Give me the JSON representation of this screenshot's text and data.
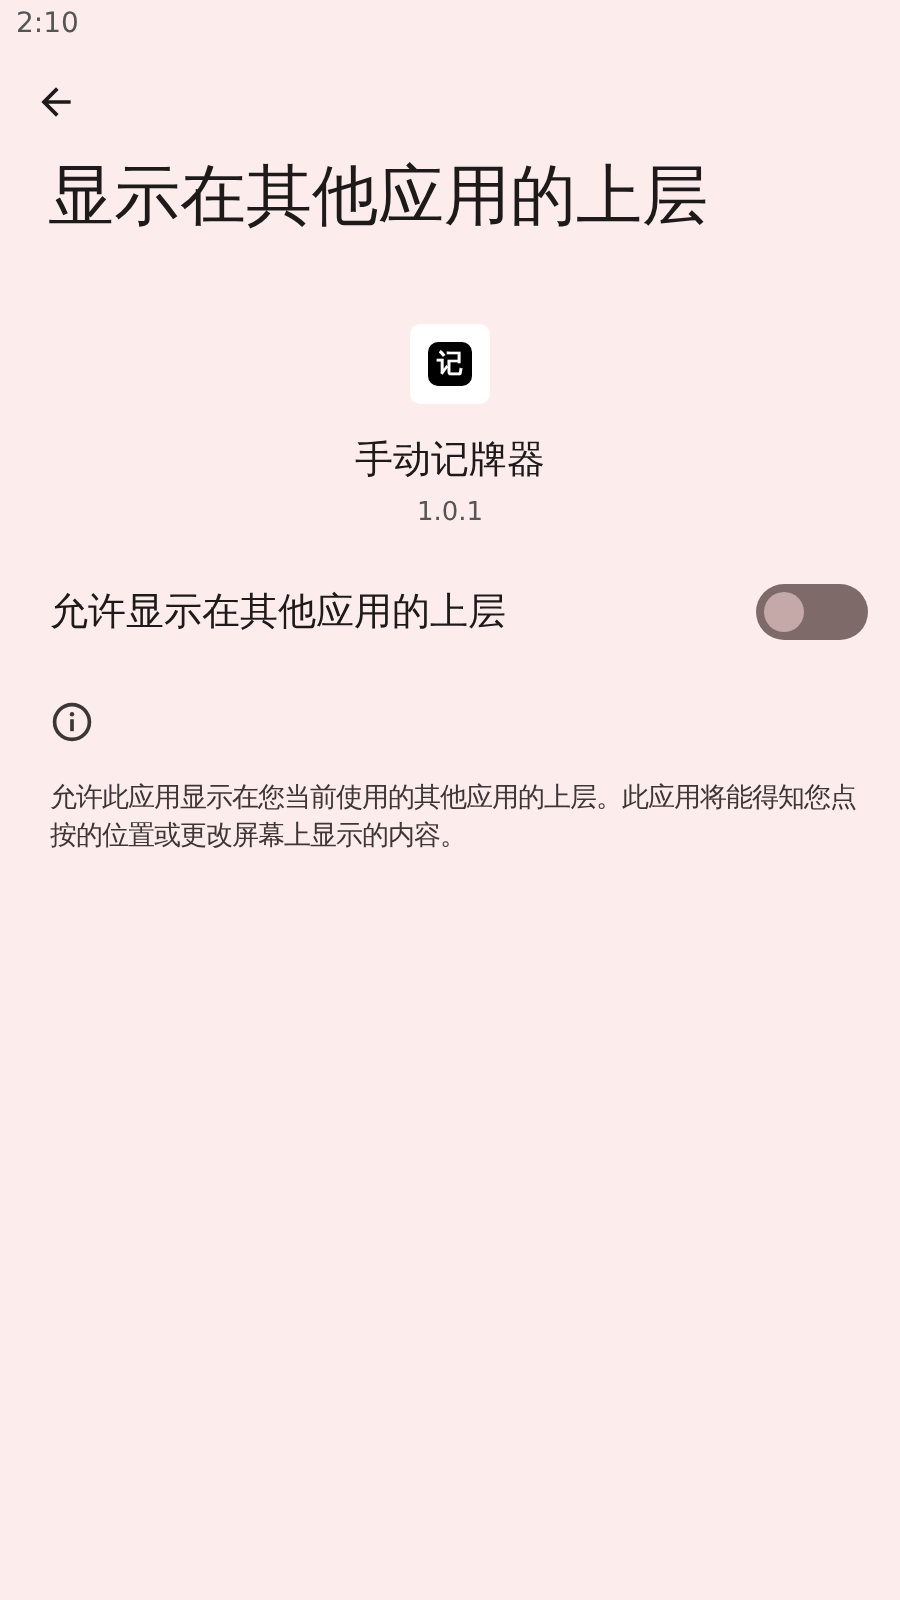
{
  "status_bar": {
    "time": "2:10"
  },
  "title": "显示在其他应用的上层",
  "app": {
    "icon_text": "记",
    "name": "手动记牌器",
    "version": "1.0.1"
  },
  "setting": {
    "label": "允许显示在其他应用的上层",
    "on": false
  },
  "description": "允许此应用显示在您当前使用的其他应用的上层。此应用将能得知您点按的位置或更改屏幕上显示的内容。"
}
